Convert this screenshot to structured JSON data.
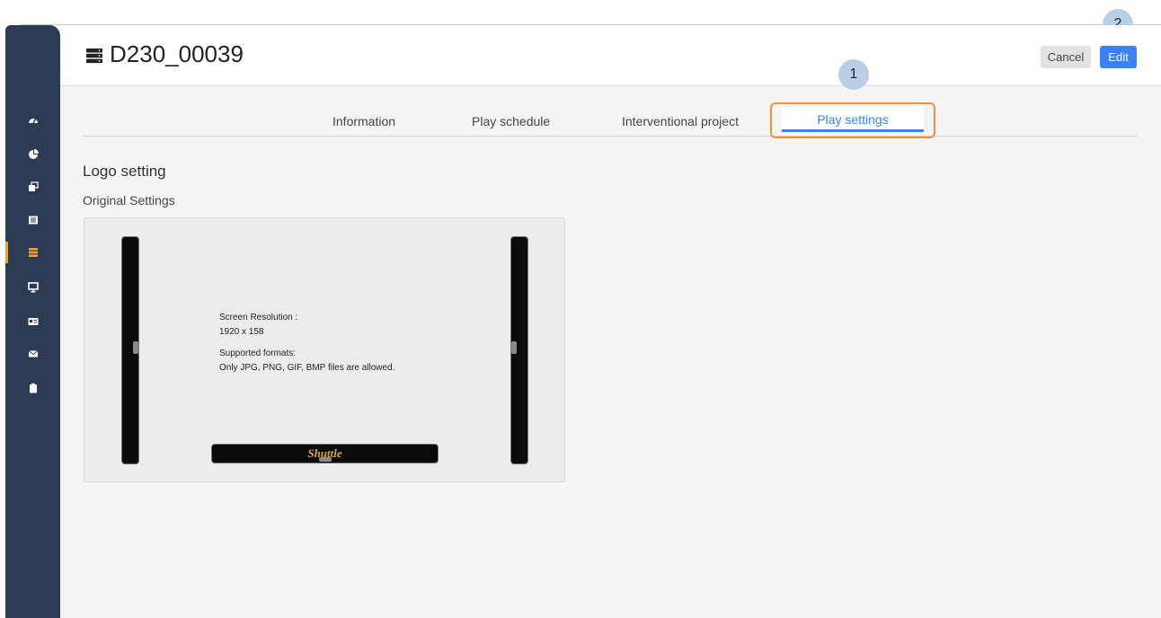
{
  "header": {
    "title": "D230_00039",
    "title_icon": "server-icon",
    "cancel_label": "Cancel",
    "edit_label": "Edit"
  },
  "sidebar": {
    "items": [
      {
        "icon": "dashboard-icon",
        "active": false
      },
      {
        "icon": "pie-chart-icon",
        "active": false
      },
      {
        "icon": "images-icon",
        "active": false
      },
      {
        "icon": "list-icon",
        "active": false
      },
      {
        "icon": "server-icon",
        "active": true
      },
      {
        "icon": "monitor-icon",
        "active": false
      },
      {
        "icon": "id-card-icon",
        "active": false
      },
      {
        "icon": "mail-icon",
        "active": false
      },
      {
        "icon": "clipboard-icon",
        "active": false
      }
    ]
  },
  "tabs": [
    {
      "label": "Information",
      "active": false
    },
    {
      "label": "Play schedule",
      "active": false
    },
    {
      "label": "Interventional project",
      "active": false
    },
    {
      "label": "Play settings",
      "active": true
    }
  ],
  "annotations": {
    "step1": "1",
    "step2": "2"
  },
  "logo": {
    "section_title": "Logo setting",
    "subsection_title": "Original Settings",
    "resolution_label": "Screen Resolution :",
    "resolution_value": "1920 x 158",
    "formats_label": "Supported formats:",
    "formats_value": "Only JPG, PNG, GIF, BMP files are allowed.",
    "brand_text": "Shuttle"
  },
  "colors": {
    "sidebar_bg": "#2c3a52",
    "active_indicator": "#f0a030",
    "accent": "#3b82f6",
    "annotation_border": "#f0923a",
    "annotation_circle": "#b9cfe8",
    "logo_text": "#d9a743"
  }
}
